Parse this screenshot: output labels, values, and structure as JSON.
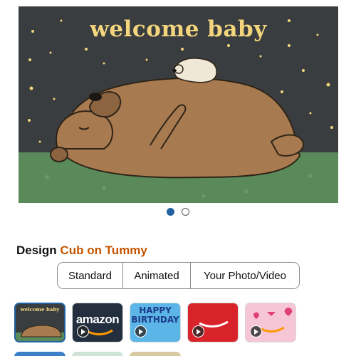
{
  "hero": {
    "title": "welcome baby"
  },
  "pager": {
    "count": 2,
    "active_index": 0
  },
  "design": {
    "label": "Design",
    "value": "Cub on Tummy"
  },
  "tabs": [
    {
      "label": "Standard"
    },
    {
      "label": "Animated"
    },
    {
      "label": "Your Photo/Video"
    }
  ],
  "thumbnails": [
    {
      "title": "welcome baby",
      "selected": true
    },
    {
      "title": "amazon"
    },
    {
      "title": "HAPPY BIRTHDAY"
    },
    {
      "title": ""
    },
    {
      "title": ""
    }
  ],
  "colors": {
    "accent": "#2162a1",
    "design_value": "#c45500",
    "hero_bg": "#3a3d3f",
    "hero_text": "#f3d57d"
  }
}
